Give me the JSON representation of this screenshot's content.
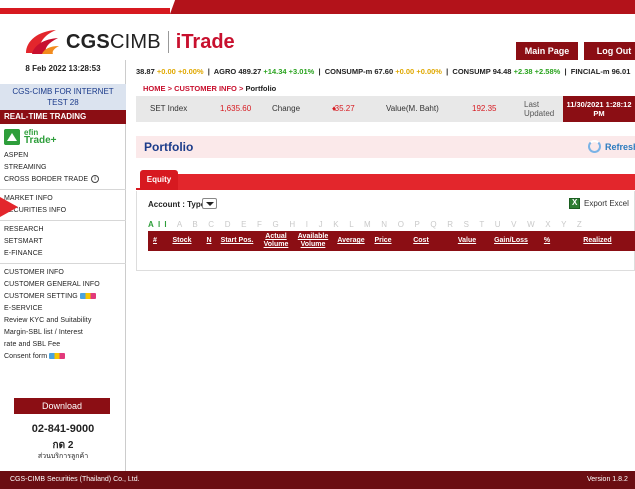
{
  "header": {
    "brand": "CGS",
    "brand_rest": "CIMB",
    "product": "iTrade",
    "main_page": "Main Page",
    "logout": "Log Out"
  },
  "sidebar": {
    "date": "8 Feb 2022 13:28:53",
    "account_line1": "CGS-CIMB FOR INTERNET",
    "account_line2": "TEST 28",
    "realtime_heading": "REAL-TIME TRADING",
    "efin_line1": "efin",
    "efin_line2": "Trade+",
    "group1": [
      "ASPEN",
      "STREAMING",
      "CROSS BORDER TRADE"
    ],
    "group2": [
      "MARKET INFO",
      "SECURITIES INFO"
    ],
    "group3": [
      "RESEARCH",
      "SETSMART",
      "E-FINANCE"
    ],
    "group4": [
      "CUSTOMER INFO",
      "CUSTOMER GENERAL INFO",
      "CUSTOMER SETTING",
      "E-SERVICE",
      "Review KYC and Suitability",
      "Margin-SBL list / Interest",
      "rate and SBL Fee",
      "Consent form"
    ],
    "download": "Download",
    "phone": "02-841-9000",
    "press": "กด 2",
    "customer_service": "ส่วนบริการลูกค้า"
  },
  "ticker": [
    {
      "name": "",
      "price": "38.87",
      "chg": "+0.00",
      "pct": "+0.00%",
      "dir": "flat"
    },
    {
      "name": "AGRO",
      "price": "489.27",
      "chg": "+14.34",
      "pct": "+3.01%",
      "dir": "up"
    },
    {
      "name": "CONSUMP-m",
      "price": "67.60",
      "chg": "+0.00",
      "pct": "+0.00%",
      "dir": "flat"
    },
    {
      "name": "CONSUMP",
      "price": "94.48",
      "chg": "+2.38",
      "pct": "+2.58%",
      "dir": "up"
    },
    {
      "name": "FINCIAL-m",
      "price": "96.01",
      "chg": "",
      "pct": "",
      "dir": "up"
    }
  ],
  "breadcrumb": {
    "home": "HOME",
    "customer_info": "CUSTOMER INFO",
    "current": "Portfolio",
    "sep": ">"
  },
  "index_bar": {
    "set_label": "SET Index",
    "set_value": "1,635.60",
    "change_label": "Change",
    "change_value": "-35.27",
    "value_label": "Value(M. Baht)",
    "value_value": "192.35",
    "last_updated_1": "Last",
    "last_updated_2": "Updated",
    "time_1": "11/30/2021 1:28:12",
    "time_2": "PM"
  },
  "portfolio": {
    "title": "Portfolio",
    "refresh": "Refresh",
    "tab_equity": "Equity",
    "account_type_label": "Account : Type",
    "export_excel": "Export Excel",
    "alpha_selected": "All",
    "alpha_rest": "A B C D E F G H I J K L M N O P Q R S T U V W X Y Z"
  },
  "table_headers": [
    "#",
    "Stock",
    "N",
    "Start Pos.",
    "Actual Volume",
    "Available Volume",
    "Average",
    "Price",
    "Cost",
    "Value",
    "Gain/Loss",
    "%",
    "Realized"
  ],
  "footer": {
    "copyright": "CGS-CIMB Securities (Thailand) Co., Ltd.",
    "version": "Version 1.8.2"
  },
  "colors": {
    "brand_red": "#d71920",
    "dark_red": "#8b0e14",
    "navy": "#1c3c8a",
    "up_green": "#2aa31f",
    "flat_yellow": "#e0a800",
    "down_red": "#e01b1b"
  }
}
